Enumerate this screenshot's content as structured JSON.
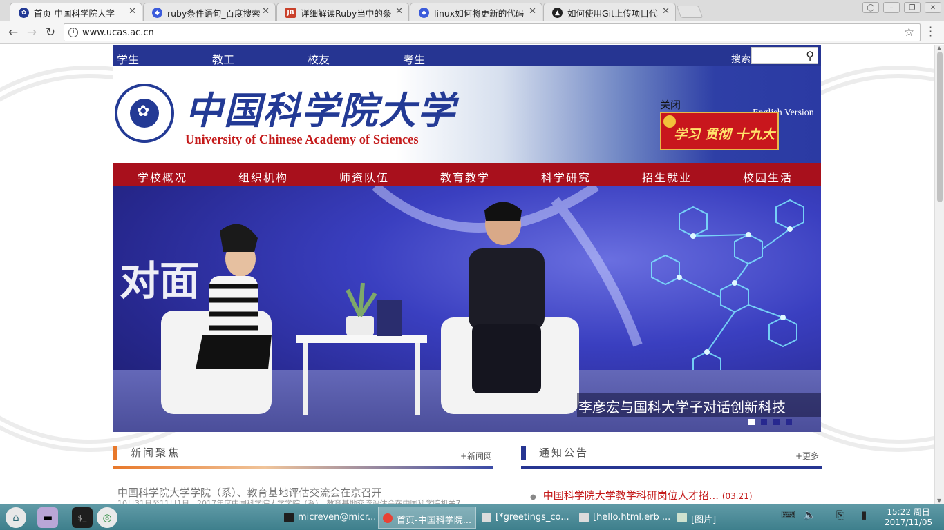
{
  "browser": {
    "tabs": [
      {
        "label": "首页-中国科学院大学",
        "favicon": "ucas-favicon",
        "color": "#233a95"
      },
      {
        "label": "ruby条件语句_百度搜索",
        "favicon": "baidu-paw-icon",
        "color": "#3b5bdb"
      },
      {
        "label": "详细解读Ruby当中的条",
        "favicon": "jb51-icon",
        "color": "#c9402a"
      },
      {
        "label": "linux如何将更新的代码",
        "favicon": "baidu-paw-icon",
        "color": "#3b5bdb"
      },
      {
        "label": "如何使用Git上传项目代",
        "favicon": "penguin-icon",
        "color": "#222222"
      }
    ],
    "url": "www.ucas.ac.cn"
  },
  "site": {
    "topnav": [
      "学生",
      "教工",
      "校友",
      "考生"
    ],
    "search_label": "搜索",
    "cn_name": "中国科学院大学",
    "en_name": "University of  Chinese Academy of Sciences",
    "close_label": "关闭",
    "english_version": "English Version",
    "promo_text": "学习 贯彻 十九大",
    "mainnav": [
      "学校概况",
      "组织机构",
      "师资队伍",
      "教育教学",
      "科学研究",
      "招生就业",
      "校园生活"
    ],
    "hero_text": "对面",
    "hero_caption": "李彦宏与国科大学子对话创新科技",
    "news": {
      "title": "新闻聚焦",
      "more": "+新闻网",
      "headline": "中国科学院大学学院（系）、教育基地评估交流会在京召开",
      "summary": "10月31日至11月1日，2017年度中国科学院大学学院（系）、教育基地交流评估会在中国科学院机关7"
    },
    "notices": {
      "title": "通知公告",
      "more": "+更多",
      "item": "中国科学院大学教学科研岗位人才招...",
      "date": "(03.21)"
    }
  },
  "taskbar": {
    "tasks": [
      "micreven@micr...",
      "首页-中国科学院...",
      "[*greetings_co...",
      "[hello.html.erb ...",
      "[图片]"
    ],
    "time": "15:22 周日",
    "date": "2017/11/05"
  },
  "colors": {
    "brand_blue": "#263592",
    "brand_red": "#a8101c",
    "news_accent": "#e8782a",
    "notice_accent": "#263592"
  }
}
